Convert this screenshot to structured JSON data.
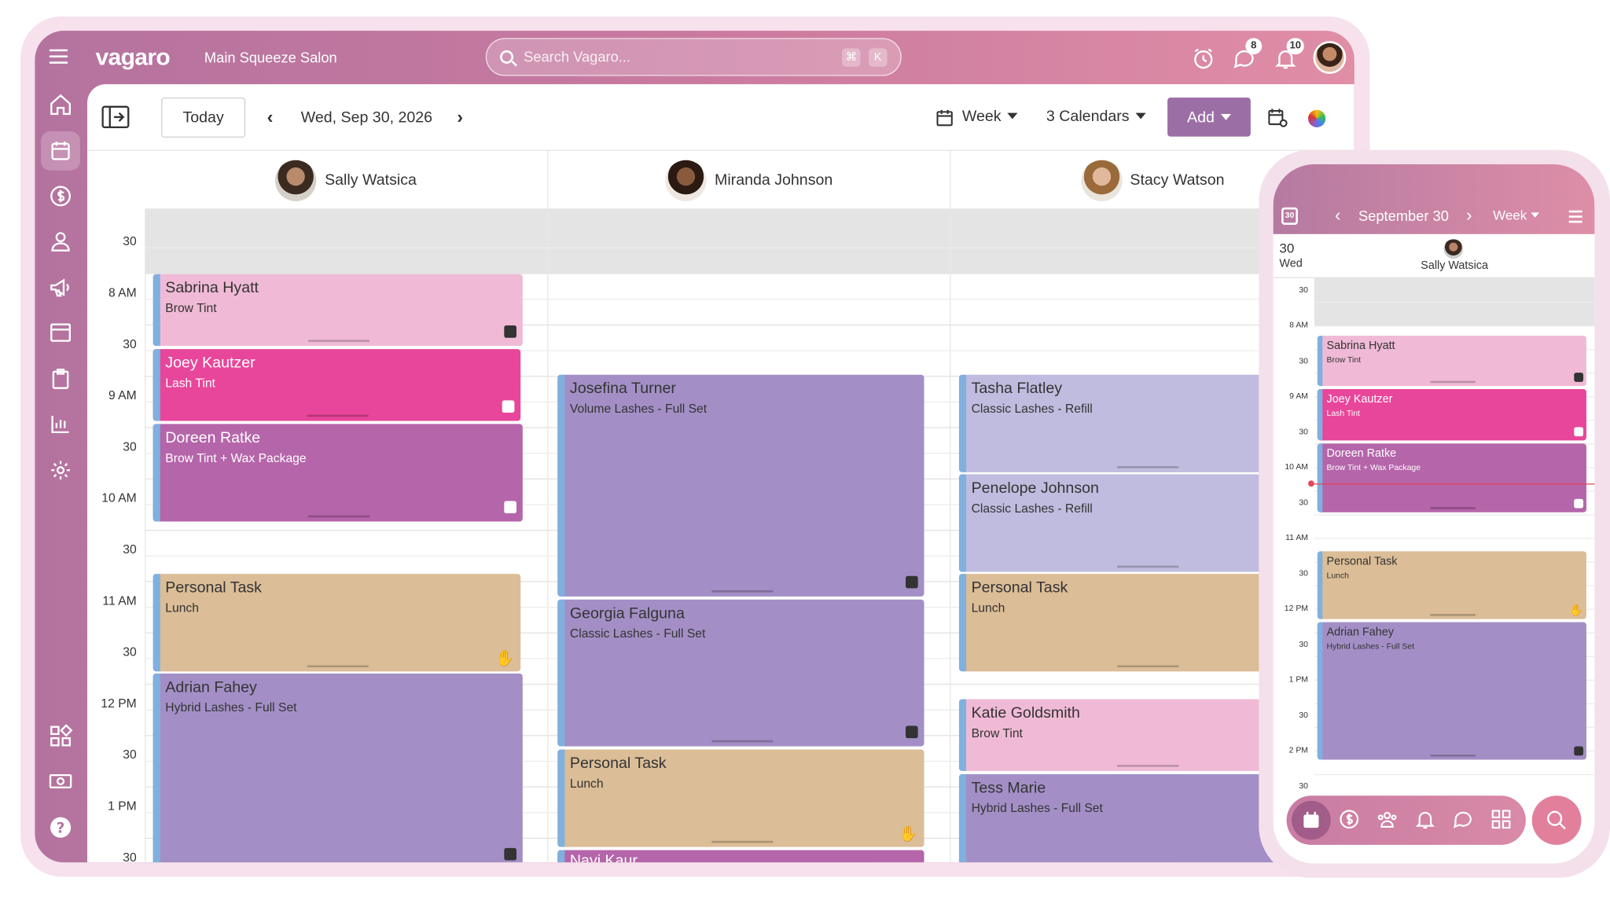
{
  "topbar": {
    "logo": "vagaro",
    "salon_name": "Main Squeeze Salon",
    "search_placeholder": "Search Vagaro...",
    "shortcut_cmd": "⌘",
    "shortcut_key": "K",
    "messages_badge": "8",
    "notifications_badge": "10"
  },
  "toolbar": {
    "today_label": "Today",
    "date": "Wed, Sep 30, 2026",
    "view_label": "Week",
    "calendars_label": "3 Calendars",
    "add_label": "Add"
  },
  "staff": [
    {
      "name": "Sally Watsica"
    },
    {
      "name": "Miranda Johnson"
    },
    {
      "name": "Stacy Watson"
    }
  ],
  "time_labels": [
    "30",
    "8 AM",
    "30",
    "9 AM",
    "30",
    "10 AM",
    "30",
    "11 AM",
    "30",
    "12 PM",
    "30",
    "1 PM",
    "30"
  ],
  "appointments": {
    "sally": [
      {
        "name": "Sabrina Hyatt",
        "service": "Brow Tint"
      },
      {
        "name": "Joey Kautzer",
        "service": "Lash Tint"
      },
      {
        "name": "Doreen Ratke",
        "service": "Brow Tint + Wax Package"
      },
      {
        "name": "Personal Task",
        "service": "Lunch"
      },
      {
        "name": "Adrian Fahey",
        "service": "Hybrid Lashes - Full Set"
      }
    ],
    "miranda": [
      {
        "name": "Josefina Turner",
        "service": "Volume Lashes - Full Set"
      },
      {
        "name": "Georgia Falguna",
        "service": "Classic Lashes - Full Set"
      },
      {
        "name": "Personal Task",
        "service": "Lunch"
      },
      {
        "name": "Navi Kaur",
        "service": ""
      }
    ],
    "stacy": [
      {
        "name": "Tasha Flatley",
        "service": "Classic Lashes - Refill"
      },
      {
        "name": "Penelope Johnson",
        "service": "Classic Lashes - Refill"
      },
      {
        "name": "Personal Task",
        "service": "Lunch"
      },
      {
        "name": "Katie Goldsmith",
        "service": "Brow Tint"
      },
      {
        "name": "Tess Marie",
        "service": "Hybrid Lashes - Full Set"
      }
    ]
  },
  "mobile": {
    "calendar_day": "30",
    "title": "September 30",
    "view_label": "Week",
    "day_number": "30",
    "weekday": "Wed",
    "staff_name": "Sally Watsica",
    "time_labels": [
      "30",
      "8 AM",
      "30",
      "9 AM",
      "30",
      "10 AM",
      "30",
      "11 AM",
      "30",
      "12 PM",
      "30",
      "1 PM",
      "30",
      "2 PM",
      "30"
    ],
    "appointments": [
      {
        "name": "Sabrina Hyatt",
        "service": "Brow Tint"
      },
      {
        "name": "Joey Kautzer",
        "service": "Lash Tint"
      },
      {
        "name": "Doreen Ratke",
        "service": "Brow Tint + Wax Package"
      },
      {
        "name": "Personal Task",
        "service": "Lunch"
      },
      {
        "name": "Adrian Fahey",
        "service": "Hybrid Lashes - Full Set"
      }
    ]
  },
  "colors": {
    "brand_gradient_start": "#b4739f",
    "brand_gradient_end": "#e08da6",
    "add_button": "#9c6ea6",
    "pink": "#f0bad6",
    "hot_pink": "#e8469a",
    "magenta": "#b565aa",
    "lavender": "#a38fc6",
    "tan": "#dbbd97",
    "periwinkle": "#c0bcdf"
  }
}
